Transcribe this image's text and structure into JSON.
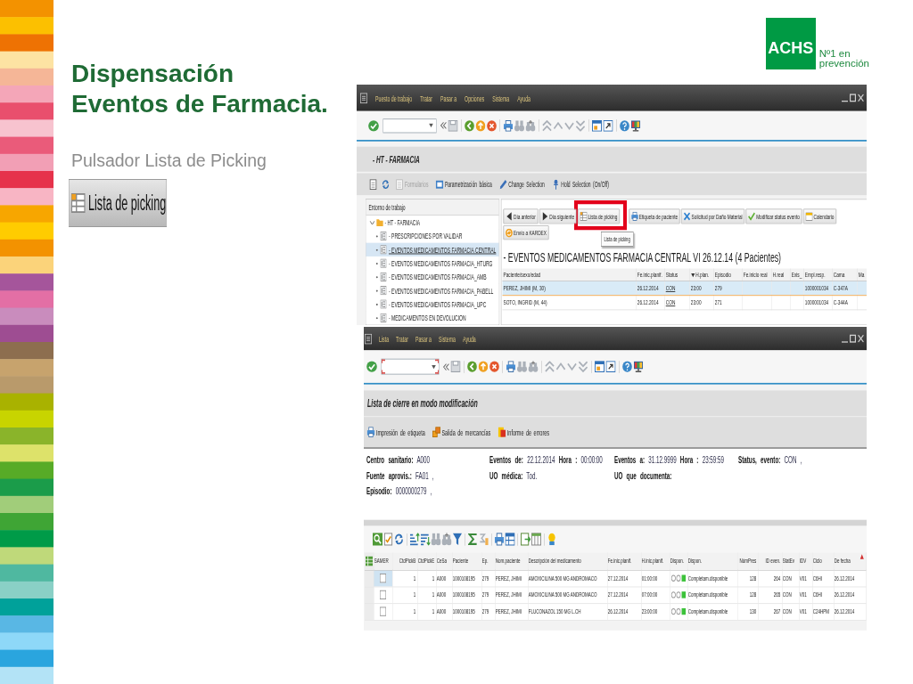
{
  "slide": {
    "title_lines": [
      "Dispensación",
      "Eventos de Farmacia."
    ],
    "subtitle": "Pulsador Lista de Picking",
    "button_sample": "Lista de picking"
  },
  "logo": {
    "mark": "ACHS",
    "tagline_lines": [
      "Nº1 en",
      "prevención"
    ]
  },
  "window_events": {
    "menu": [
      "Puesto de trabajo",
      "Tratar",
      "Pasar a",
      "Opciones",
      "Sistema",
      "Ayuda"
    ],
    "command_field": {
      "focused": false
    },
    "title": "- HT - FARMACIA",
    "app_toolbar": [
      {
        "kind": "forms",
        "label": "Formularios",
        "disabled": true
      },
      {
        "kind": "params",
        "label": "Parametrización básica",
        "disabled": false
      },
      {
        "kind": "change",
        "label": "Change Selection",
        "disabled": false
      },
      {
        "kind": "hold",
        "label": "Hold Selection (On/Off)",
        "disabled": false
      }
    ],
    "sidebar": {
      "title": "Entorno de trabajo",
      "tree": [
        {
          "label": "- HT - FARMACIA",
          "expanded": true,
          "selected": false,
          "children": [
            {
              "label": "- PRESCRIPCIONES POR VALIDAR",
              "selected": false
            },
            {
              "label": "- EVENTOS MEDICAMENTOS FARMACIA CENTRAL",
              "selected": true
            },
            {
              "label": "- EVENTOS MEDICAMENTOS FARMACIA_HTURG",
              "selected": false
            },
            {
              "label": "- EVENTOS MEDICAMENTOS FARMACIA_AMB",
              "selected": false
            },
            {
              "label": "- EVENTOS MEDICAMENTOS FARMACIA_PABELL",
              "selected": false
            },
            {
              "label": "- EVENTOS MEDICAMENTOS FARMACIA_UPC",
              "selected": false
            },
            {
              "label": "- MEDICAMENTOS EN DEVOLUCION",
              "selected": false
            }
          ]
        }
      ]
    },
    "action_rows": [
      [
        {
          "kind": "prev",
          "label": "Día anterior",
          "highlighted": false
        },
        {
          "kind": "next",
          "label": "Día siguiente",
          "highlighted": false
        },
        {
          "kind": "picking",
          "label": "Lista de picking",
          "highlighted": true,
          "tooltip": "Lista de picking"
        },
        {
          "kind": "label",
          "label": "Etiqueta de paciente",
          "highlighted": false
        },
        {
          "kind": "damage",
          "label": "Solicitud por Daño Material",
          "highlighted": false
        },
        {
          "kind": "status",
          "label": "Modificar status evento",
          "highlighted": false
        },
        {
          "kind": "calendar",
          "label": "Calendario",
          "highlighted": false
        }
      ],
      [
        {
          "kind": "kardex",
          "label": "Envío a KARDEX",
          "highlighted": false
        }
      ]
    ],
    "table": {
      "heading": "- EVENTOS MEDICAMENTOS FARMACIA CENTRAL VI 26.12.14 (4 Pacientes)",
      "columns": [
        {
          "label": "Paciente/sexo/edad",
          "sorted": false
        },
        {
          "label": "Fe.inic.planif.",
          "sorted": false
        },
        {
          "label": "Status",
          "sorted": false
        },
        {
          "label": "H.plan.",
          "sorted": true
        },
        {
          "label": "Episodio",
          "sorted": false
        },
        {
          "label": "Fe.inicio real",
          "sorted": false
        },
        {
          "label": "H.real",
          "sorted": false
        },
        {
          "label": "Exis_",
          "sorted": false
        },
        {
          "label": "Empl.resp.",
          "sorted": false
        },
        {
          "label": "Cama",
          "sorted": false
        },
        {
          "label": "Ma",
          "sorted": false
        }
      ],
      "rows": [
        {
          "selected": true,
          "patient": "PEREZ, JHIMI (M, 30)",
          "planned_date": "26.12.2014",
          "status": "CON",
          "planned_time": "23:00",
          "episode": "279",
          "responsible": "1000001034",
          "bed": "C-347A"
        },
        {
          "selected": false,
          "patient": "SOTO, INGRID (M, 44)",
          "planned_date": "26.12.2014",
          "status": "CON",
          "planned_time": "23:00",
          "episode": "271",
          "responsible": "1000001034",
          "bed": "C-344A"
        }
      ]
    }
  },
  "window_list": {
    "menu": [
      "Lista",
      "Tratar",
      "Pasar a",
      "Sistema",
      "Ayuda"
    ],
    "command_field": {
      "focused": true
    },
    "title": "Lista de cierre en modo modificación",
    "app_toolbar": [
      {
        "kind": "print",
        "label": "Impresión de etiqueta",
        "disabled": false
      },
      {
        "kind": "goods",
        "label": "Salida de mercancías",
        "disabled": false
      },
      {
        "kind": "errors",
        "label": "Informe de errores",
        "disabled": false
      }
    ],
    "info_columns": [
      [
        {
          "kind": "field",
          "text": "**Centro sanitario:** A000"
        },
        {
          "kind": "field",
          "text": "**Fuente aprovis.:** FA01 ,"
        },
        {
          "kind": "field",
          "text": "**Episodio:** 0000000279 ,"
        }
      ],
      [
        {
          "kind": "field",
          "text": "**Eventos de:** 22.12.2014 **Hora :** 00:00:00"
        },
        {
          "kind": "field",
          "text": "**UO médica:** Tod."
        }
      ],
      [
        {
          "kind": "field",
          "text": "**Eventos a:** 31.12.9999 **Hora :** 23:59:59"
        },
        {
          "kind": "label",
          "text": "UO que documenta:"
        }
      ],
      [
        {
          "kind": "field",
          "text": "**Status, evento:** CON ,"
        }
      ]
    ],
    "table": {
      "columns": [
        "SAMER",
        "CtdPickB",
        "CtdPickE",
        "CeSa",
        "Paciente",
        "Ep.",
        "Nom.paciente",
        "Descripción del medicamento",
        "Fe.inic.planif.",
        "H.inic.planif.",
        "Dispon.",
        "Dispon.",
        "NúmPres",
        "ID even.",
        "StatEv",
        "IDV",
        "Ciclo",
        "De fecha"
      ],
      "rows": [
        {
          "selected": true,
          "checked": false,
          "picked_b": "1",
          "picked_e": "1",
          "cesa": "A000",
          "patient_id": "1000108195",
          "episode": "279",
          "patient_name": "PEREZ, JHIMI",
          "medication": "AMOXICILINA 500 MG ANDROMACO",
          "planned_date": "27.12.2014",
          "planned_time": "01:00:00",
          "available": true,
          "availability": "Completam.disponible",
          "num_pres": "128",
          "event_id": "264",
          "event_status": "CON",
          "idv": "V01",
          "cycle": "C6HI",
          "from_date": "26.12.2014"
        },
        {
          "selected": false,
          "checked": false,
          "picked_b": "1",
          "picked_e": "1",
          "cesa": "A000",
          "patient_id": "1000108195",
          "episode": "279",
          "patient_name": "PEREZ, JHIMI",
          "medication": "AMOXICILINA 500 MG ANDROMACO",
          "planned_date": "27.12.2014",
          "planned_time": "07:00:00",
          "available": true,
          "availability": "Completam.disponible",
          "num_pres": "128",
          "event_id": "265",
          "event_status": "CON",
          "idv": "V01",
          "cycle": "C6HI",
          "from_date": "26.12.2014"
        },
        {
          "selected": false,
          "checked": false,
          "picked_b": "1",
          "picked_e": "1",
          "cesa": "A000",
          "patient_id": "1000108195",
          "episode": "279",
          "patient_name": "PEREZ, JHIMI",
          "medication": "FLUCONAZOL 150 MG L.CH",
          "planned_date": "26.12.2014",
          "planned_time": "23:00:00",
          "available": true,
          "availability": "Completam.disponible",
          "num_pres": "130",
          "event_id": "267",
          "event_status": "CON",
          "idv": "V01",
          "cycle": "C24HPM",
          "from_date": "26.12.2014"
        }
      ]
    }
  }
}
